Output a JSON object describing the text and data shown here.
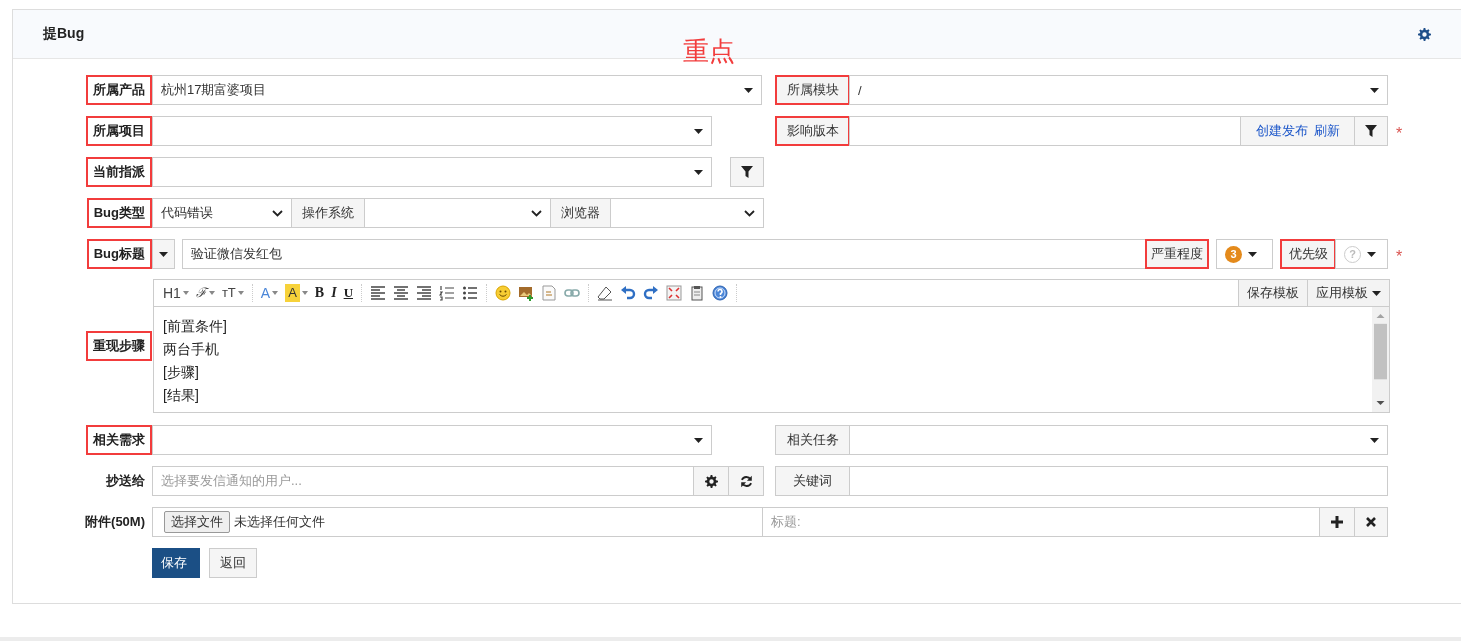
{
  "page_title": "提Bug",
  "annotation": "重点",
  "product": {
    "label": "所属产品",
    "value": "杭州17期富婆项目",
    "highlighted": true
  },
  "module": {
    "label": "所属模块",
    "value": "/",
    "highlighted": true
  },
  "project": {
    "label": "所属项目",
    "highlighted": true
  },
  "version": {
    "label": "影响版本",
    "links": [
      "创建发布",
      "刷新"
    ],
    "required_mark": "*",
    "highlighted": true
  },
  "assignee": {
    "label": "当前指派",
    "highlighted": true
  },
  "type": {
    "label": "Bug类型",
    "value": "代码错误",
    "os_label": "操作系统",
    "browser_label": "浏览器",
    "highlighted": true
  },
  "title": {
    "label": "Bug标题",
    "value": "验证微信发红包",
    "severity_label": "严重程度",
    "severity": "3",
    "priority_label": "优先级",
    "priority": "?",
    "required_mark": "*",
    "highlighted": true,
    "severity_highlighted": true,
    "priority_highlighted": true
  },
  "steps": {
    "label": "重现步骤",
    "highlighted": true,
    "toolbar": [
      [
        {
          "kind": "heading",
          "glyph": "H1"
        },
        {
          "kind": "font",
          "glyph": "ℱ"
        },
        {
          "kind": "size",
          "glyph": "ᴛT"
        }
      ],
      [
        {
          "kind": "color",
          "glyph": "A"
        },
        {
          "kind": "highlight",
          "glyph": "A"
        },
        {
          "kind": "bold",
          "glyph": "B"
        },
        {
          "kind": "italic",
          "glyph": "I"
        },
        {
          "kind": "underline",
          "glyph": "U"
        }
      ],
      [
        {
          "kind": "align-left"
        },
        {
          "kind": "align-center"
        },
        {
          "kind": "align-right"
        },
        {
          "kind": "ordered-list"
        },
        {
          "kind": "bullet-list"
        }
      ],
      [
        {
          "kind": "emoji"
        },
        {
          "kind": "image"
        },
        {
          "kind": "code"
        },
        {
          "kind": "link"
        }
      ],
      [
        {
          "kind": "eraser"
        },
        {
          "kind": "undo"
        },
        {
          "kind": "redo"
        },
        {
          "kind": "fullscreen"
        },
        {
          "kind": "paste"
        },
        {
          "kind": "help"
        }
      ]
    ],
    "template_buttons": [
      "保存模板",
      "应用模板"
    ],
    "lines": [
      "[前置条件]",
      "两台手机",
      "[步骤]",
      "[结果]"
    ]
  },
  "story": {
    "label": "相关需求",
    "highlighted": true
  },
  "task": {
    "label": "相关任务"
  },
  "mailto": {
    "label": "抄送给",
    "placeholder": "选择要发信通知的用户..."
  },
  "keywords": {
    "label": "关键词"
  },
  "files": {
    "label": "附件(50M)",
    "button": "选择文件",
    "status": "未选择任何文件",
    "title_placeholder": "标题:"
  },
  "actions": [
    "保存",
    "返回"
  ]
}
